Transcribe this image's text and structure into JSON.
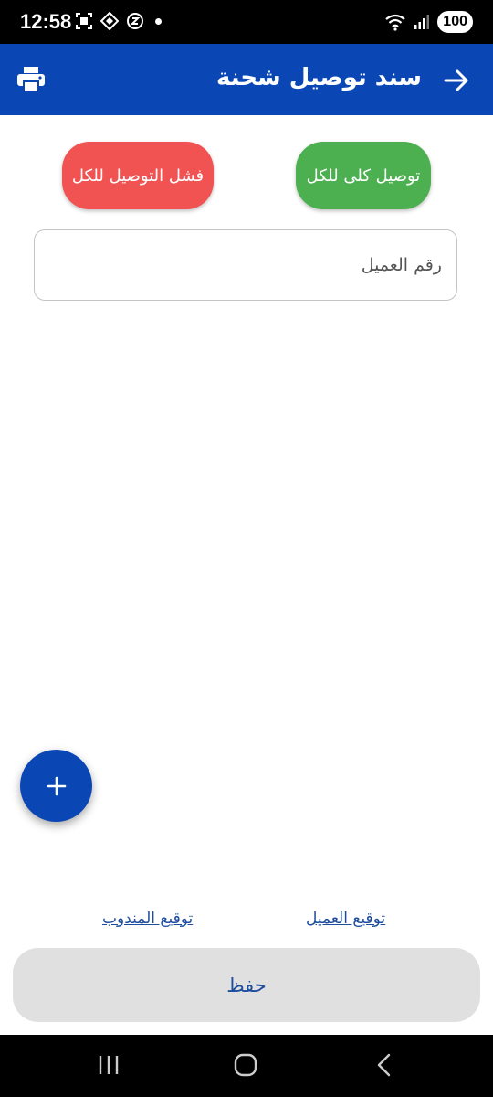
{
  "status_bar": {
    "time": "12:58",
    "battery": "100"
  },
  "app_bar": {
    "title": "سند توصيل شحنة"
  },
  "actions": {
    "deliver_all": "توصيل كلى للكل",
    "fail_all": "فشل التوصيل للكل"
  },
  "customer_number": {
    "placeholder": "رقم العميل",
    "value": ""
  },
  "signatures": {
    "customer": "توقيع العميل",
    "representative": "توقيع المندوب"
  },
  "save_label": "حفظ",
  "colors": {
    "primary": "#0a47b5",
    "success": "#4caf50",
    "danger": "#f05352",
    "link": "#1e4d9e",
    "save_bg": "#e0e0e0"
  },
  "icons": {
    "print": "print-icon",
    "back": "arrow-right-icon",
    "add": "plus-icon"
  }
}
